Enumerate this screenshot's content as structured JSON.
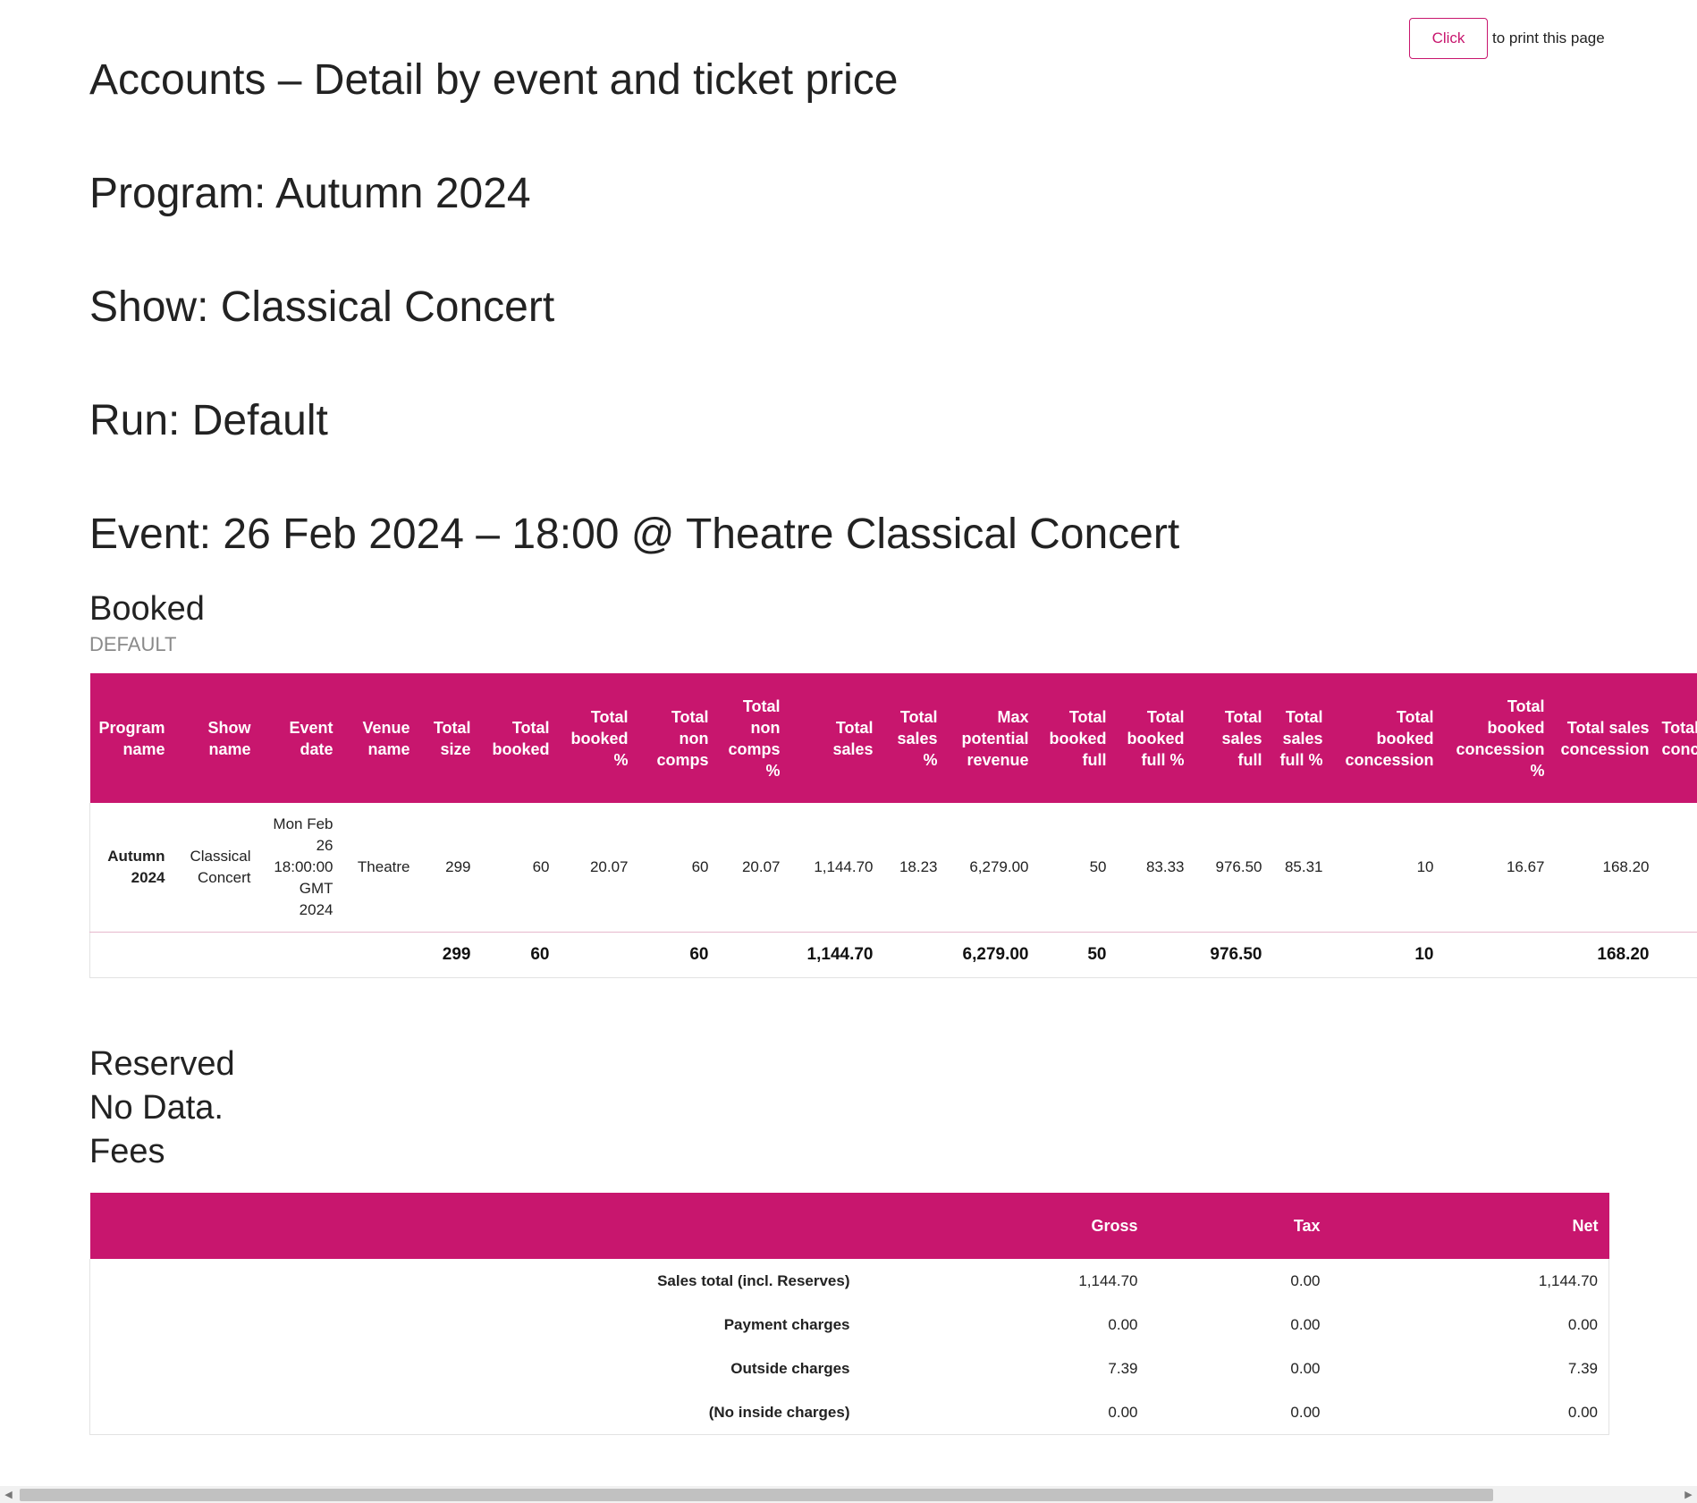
{
  "print": {
    "button_label": "Click",
    "text": "to print this page"
  },
  "header": {
    "title": "Accounts – Detail by event and ticket price",
    "program": "Program: Autumn 2024",
    "show": "Show: Classical Concert",
    "run": "Run: Default",
    "event": "Event: 26 Feb 2024 – 18:00 @ Theatre Classical Concert"
  },
  "booked": {
    "title": "Booked",
    "subtitle": "DEFAULT",
    "columns": [
      "Program name",
      "Show name",
      "Event date",
      "Venue name",
      "Total size",
      "Total booked",
      "Total booked %",
      "Total non comps",
      "Total non comps %",
      "Total sales",
      "Total sales %",
      "Max potential revenue",
      "Total booked full",
      "Total booked full %",
      "Total sales full",
      "Total sales full %",
      "Total booked concession",
      "Total booked concession %",
      "Total sales concession",
      "Total sales concession"
    ],
    "row": {
      "program": "Autumn 2024",
      "show": "Classical Concert",
      "event_date": "Mon Feb 26 18:00:00 GMT 2024",
      "venue": "Theatre",
      "total_size": "299",
      "total_booked": "60",
      "total_booked_pct": "20.07",
      "total_non_comps": "60",
      "total_non_comps_pct": "20.07",
      "total_sales": "1,144.70",
      "total_sales_pct": "18.23",
      "max_potential_revenue": "6,279.00",
      "total_booked_full": "50",
      "total_booked_full_pct": "83.33",
      "total_sales_full": "976.50",
      "total_sales_full_pct": "85.31",
      "total_booked_concession": "10",
      "total_booked_concession_pct": "16.67",
      "total_sales_concession": "168.20",
      "total_sales_concession_pct": ""
    },
    "totals": {
      "total_size": "299",
      "total_booked": "60",
      "total_non_comps": "60",
      "total_sales": "1,144.70",
      "max_potential_revenue": "6,279.00",
      "total_booked_full": "50",
      "total_sales_full": "976.50",
      "total_booked_concession": "10",
      "total_sales_concession": "168.20"
    }
  },
  "reserved": {
    "title": "Reserved",
    "no_data": "No Data."
  },
  "fees": {
    "title": "Fees",
    "columns": {
      "label": "",
      "gross": "Gross",
      "tax": "Tax",
      "net": "Net"
    },
    "rows": [
      {
        "label": "Sales total (incl. Reserves)",
        "gross": "1,144.70",
        "tax": "0.00",
        "net": "1,144.70"
      },
      {
        "label": "Payment charges",
        "gross": "0.00",
        "tax": "0.00",
        "net": "0.00"
      },
      {
        "label": "Outside charges",
        "gross": "7.39",
        "tax": "0.00",
        "net": "7.39"
      },
      {
        "label": "(No inside charges)",
        "gross": "0.00",
        "tax": "0.00",
        "net": "0.00"
      }
    ]
  },
  "colors": {
    "accent": "#c8166e"
  }
}
